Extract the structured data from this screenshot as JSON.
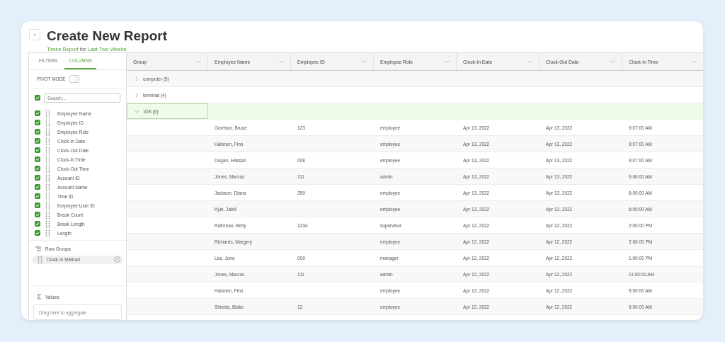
{
  "header": {
    "back_button": "‹",
    "title": "Create New Report",
    "subtitle": {
      "report": "Times Report",
      "joiner": "for",
      "range": "Last Two Weeks"
    }
  },
  "sidebar": {
    "tabs": [
      {
        "label": "FILTERS",
        "selected": false
      },
      {
        "label": "COLUMNS",
        "selected": true
      }
    ],
    "pivot_mode": {
      "label": "PIVOT MODE",
      "on": false
    },
    "select_all_checked": true,
    "search": {
      "placeholder": "Search..."
    },
    "columns": [
      {
        "label": "Employee Name",
        "checked": true
      },
      {
        "label": "Employee ID",
        "checked": true
      },
      {
        "label": "Employee Role",
        "checked": true
      },
      {
        "label": "Clock-In Date",
        "checked": true
      },
      {
        "label": "Clock-Out Date",
        "checked": true
      },
      {
        "label": "Clock-In Time",
        "checked": true
      },
      {
        "label": "Clock-Out Time",
        "checked": true
      },
      {
        "label": "Account ID",
        "checked": true
      },
      {
        "label": "Account Name",
        "checked": true
      },
      {
        "label": "Time ID",
        "checked": true
      },
      {
        "label": "Employee User ID",
        "checked": true
      },
      {
        "label": "Break Count",
        "checked": true
      },
      {
        "label": "Break Length",
        "checked": true
      },
      {
        "label": "Length",
        "checked": true
      }
    ],
    "row_groups": {
      "title": "Row Groups",
      "items": [
        "Clock In Method"
      ]
    },
    "values": {
      "title": "Values",
      "placeholder": "Drag here to aggregate"
    }
  },
  "table": {
    "columns": [
      "Group",
      "Employee Name",
      "Employee ID",
      "Employee Role",
      "Clock-In Date",
      "Clock-Out Date",
      "Clock-In Time"
    ],
    "rows": [
      {
        "kind": "group",
        "label": "computer (5)",
        "expanded": false,
        "selected": false
      },
      {
        "kind": "group",
        "label": "terminal (4)",
        "expanded": false,
        "selected": false
      },
      {
        "kind": "group",
        "label": "iOS (6)",
        "expanded": true,
        "selected": true
      },
      {
        "kind": "data",
        "cells": [
          "Garrison, Bruce",
          "123",
          "employee",
          "Apr 13, 2022",
          "Apr 13, 2022",
          "9:07:00 AM"
        ]
      },
      {
        "kind": "data",
        "cells": [
          "Halonen, Finn",
          "",
          "employee",
          "Apr 13, 2022",
          "Apr 13, 2022",
          "9:07:00 AM"
        ]
      },
      {
        "kind": "data",
        "cells": [
          "Dogan, Hassan",
          "008",
          "employee",
          "Apr 13, 2022",
          "Apr 13, 2022",
          "9:07:00 AM"
        ]
      },
      {
        "kind": "data",
        "cells": [
          "Jones, Marcus",
          "111",
          "admin",
          "Apr 13, 2022",
          "Apr 13, 2022",
          "9:06:00 AM"
        ]
      },
      {
        "kind": "data",
        "cells": [
          "Jackson, Diana",
          "259",
          "employee",
          "Apr 13, 2022",
          "Apr 13, 2022",
          "6:00:00 AM"
        ]
      },
      {
        "kind": "data",
        "cells": [
          "Kyle, Jahlil",
          "",
          "employee",
          "Apr 13, 2022",
          "Apr 13, 2022",
          "6:00:00 AM"
        ]
      },
      {
        "kind": "data",
        "cells": [
          "Rathman, Betty",
          "1234",
          "supervisor",
          "Apr 12, 2022",
          "Apr 12, 2022",
          "2:00:00 PM"
        ]
      },
      {
        "kind": "data",
        "cells": [
          "Richards, Margery",
          "",
          "employee",
          "Apr 12, 2022",
          "Apr 12, 2022",
          "2:00:00 PM"
        ]
      },
      {
        "kind": "data",
        "cells": [
          "Lee, June",
          "009",
          "manager",
          "Apr 12, 2022",
          "Apr 12, 2022",
          "1:00:00 PM"
        ]
      },
      {
        "kind": "data",
        "cells": [
          "Jones, Marcus",
          "111",
          "admin",
          "Apr 12, 2022",
          "Apr 12, 2022",
          "11:00:00 AM"
        ]
      },
      {
        "kind": "data",
        "cells": [
          "Halonen, Finn",
          "",
          "employee",
          "Apr 12, 2022",
          "Apr 12, 2022",
          "9:00:00 AM"
        ]
      },
      {
        "kind": "data",
        "cells": [
          "Shields, Blake",
          "12",
          "employee",
          "Apr 12, 2022",
          "Apr 12, 2022",
          "9:00:00 AM"
        ]
      }
    ]
  }
}
